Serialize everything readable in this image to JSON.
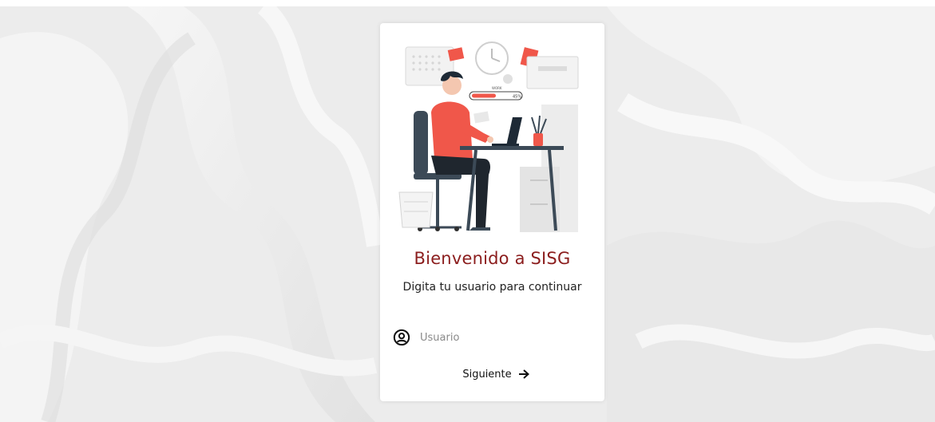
{
  "login": {
    "title": "Bienvenido a SISG",
    "subtitle": "Digita tu usuario para continuar",
    "username_placeholder": "Usuario",
    "username_value": "",
    "next_label": "Siguiente",
    "illustration_progress_percent": "45%"
  },
  "colors": {
    "title": "#8b1d1d",
    "accent": "#f0574a",
    "background": "#eeeeee",
    "card": "#ffffff"
  },
  "icons": {
    "user": "user-circle-icon",
    "next": "arrow-right-icon"
  }
}
